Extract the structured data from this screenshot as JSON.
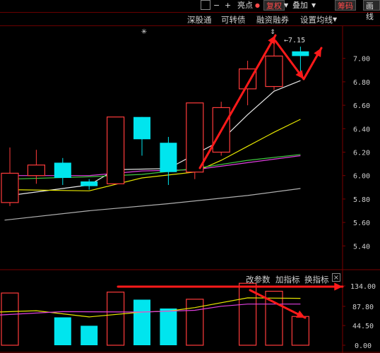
{
  "toolbar": {
    "highlight": "亮点",
    "fq": "复权",
    "overlay": "叠加",
    "chips": "筹码",
    "draw": "画线",
    "minus": "−",
    "plus": "+"
  },
  "menu": {
    "items": [
      "深股通",
      "可转债",
      "融资融券",
      "设置均线"
    ]
  },
  "indicator_bar": {
    "change_params": "改参数",
    "add_indicator": "加指标",
    "switch_indicator": "换指标",
    "close": "×"
  },
  "colors": {
    "up": "#ff3b3b",
    "down": "#00e5ee",
    "ma_white": "#e8e8e8",
    "ma_yellow": "#e6e600",
    "ma_magenta": "#e040e0",
    "ma_green": "#40c840",
    "ma_gray": "#b0b0b0",
    "annotation": "#ff1a1a",
    "axis_grid": "#7a0000"
  },
  "chart_data": [
    {
      "type": "candlestick",
      "y_ticks": [
        "7.00",
        "6.80",
        "6.60",
        "6.40",
        "6.20",
        "6.00",
        "5.80",
        "5.60",
        "5.40"
      ],
      "ylim": [
        5.28,
        7.36
      ],
      "high_marker_label": "7.15",
      "candles": [
        {
          "o": 5.77,
          "c": 6.02,
          "h": 6.24,
          "l": 5.74,
          "dir": "up"
        },
        {
          "o": 6.0,
          "c": 6.09,
          "h": 6.22,
          "l": 5.93,
          "dir": "up"
        },
        {
          "o": 6.11,
          "c": 5.98,
          "h": 6.15,
          "l": 5.92,
          "dir": "down"
        },
        {
          "o": 5.95,
          "c": 5.91,
          "h": 5.97,
          "l": 5.88,
          "dir": "down"
        },
        {
          "o": 5.93,
          "c": 6.5,
          "h": 6.5,
          "l": 5.93,
          "dir": "up"
        },
        {
          "o": 6.5,
          "c": 6.31,
          "h": 6.5,
          "l": 6.17,
          "dir": "down"
        },
        {
          "o": 6.28,
          "c": 6.03,
          "h": 6.33,
          "l": 5.92,
          "dir": "down"
        },
        {
          "o": 6.03,
          "c": 6.62,
          "h": 6.62,
          "l": 5.97,
          "dir": "up"
        },
        {
          "o": 6.2,
          "c": 6.58,
          "h": 6.63,
          "l": 6.17,
          "dir": "up"
        },
        {
          "o": 6.74,
          "c": 6.91,
          "h": 6.98,
          "l": 6.6,
          "dir": "up"
        },
        {
          "o": 6.76,
          "c": 7.02,
          "h": 7.15,
          "l": 6.73,
          "dir": "up"
        },
        {
          "o": 7.06,
          "c": 7.02,
          "h": 7.1,
          "l": 6.85,
          "dir": "down"
        }
      ],
      "ma_lines": [
        {
          "color": "ma_white",
          "points": [
            [
              0,
              5.83
            ],
            [
              3,
              5.92
            ],
            [
              4,
              6.05
            ],
            [
              6,
              6.06
            ],
            [
              8,
              6.3
            ],
            [
              9,
              6.52
            ],
            [
              10,
              6.72
            ],
            [
              11,
              6.81
            ]
          ]
        },
        {
          "color": "ma_yellow",
          "points": [
            [
              0,
              5.88
            ],
            [
              3,
              5.87
            ],
            [
              5,
              5.98
            ],
            [
              7,
              6.03
            ],
            [
              8,
              6.13
            ],
            [
              9,
              6.25
            ],
            [
              10,
              6.37
            ],
            [
              11,
              6.48
            ]
          ]
        },
        {
          "color": "ma_magenta",
          "points": [
            [
              0,
              6.0
            ],
            [
              3,
              6.0
            ],
            [
              5,
              6.04
            ],
            [
              7,
              6.05
            ],
            [
              9,
              6.11
            ],
            [
              11,
              6.17
            ]
          ]
        },
        {
          "color": "ma_green",
          "points": [
            [
              0,
              5.97
            ],
            [
              3,
              5.99
            ],
            [
              5,
              6.01
            ],
            [
              7,
              6.06
            ],
            [
              9,
              6.13
            ],
            [
              11,
              6.18
            ]
          ]
        },
        {
          "color": "ma_gray",
          "points": [
            [
              -0.2,
              5.62
            ],
            [
              3,
              5.7
            ],
            [
              6,
              5.76
            ],
            [
              9,
              5.83
            ],
            [
              11,
              5.89
            ]
          ]
        }
      ]
    },
    {
      "type": "bar",
      "y_ticks": [
        "134.00",
        "87.80",
        "44.50",
        "0.00"
      ],
      "ylim": [
        0,
        134
      ],
      "bars": [
        {
          "v": 118,
          "dir": "up"
        },
        {
          "v": 0,
          "dir": "up"
        },
        {
          "v": 63,
          "dir": "down"
        },
        {
          "v": 44,
          "dir": "down"
        },
        {
          "v": 120,
          "dir": "up"
        },
        {
          "v": 103,
          "dir": "down"
        },
        {
          "v": 83,
          "dir": "down"
        },
        {
          "v": 104,
          "dir": "up"
        },
        {
          "v": 0,
          "dir": "up"
        },
        {
          "v": 140,
          "dir": "up"
        },
        {
          "v": 122,
          "dir": "up"
        },
        {
          "v": 65,
          "dir": "up"
        }
      ],
      "ma_lines": [
        {
          "color": "ma_yellow",
          "points": [
            [
              -0.5,
              75
            ],
            [
              1,
              78
            ],
            [
              3,
              64
            ],
            [
              5,
              75
            ],
            [
              6,
              77
            ],
            [
              7,
              85
            ],
            [
              9,
              107
            ],
            [
              11,
              106
            ]
          ]
        },
        {
          "color": "ma_magenta",
          "points": [
            [
              -0.5,
              68
            ],
            [
              2,
              76
            ],
            [
              5,
              75
            ],
            [
              7,
              79
            ],
            [
              8,
              88
            ],
            [
              9,
              93
            ],
            [
              11,
              93
            ]
          ]
        }
      ]
    }
  ]
}
